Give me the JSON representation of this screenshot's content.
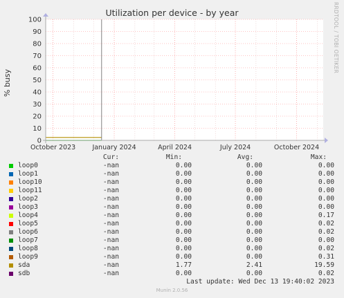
{
  "title": "Utilization per device - by year",
  "side_label": "RRDTOOL / TOBI OETIKER",
  "footer": "Munin 2.0.56",
  "last_update": "Last update: Wed Dec 13 19:40:02 2023",
  "colors": {
    "grid_minor": "#e0b0b0",
    "grid_major": "#ff9f9f",
    "background": "#ffffff",
    "axis": "#aaaaaa"
  },
  "legend": {
    "headers": [
      "Cur:",
      "Min:",
      "Avg:",
      "Max:"
    ],
    "rows": [
      {
        "name": "loop0",
        "color": "#00cc00",
        "cur": "-nan",
        "min": "0.00",
        "avg": "0.00",
        "max": "0.00"
      },
      {
        "name": "loop1",
        "color": "#0066b3",
        "cur": "-nan",
        "min": "0.00",
        "avg": "0.00",
        "max": "0.00"
      },
      {
        "name": "loop10",
        "color": "#ff8000",
        "cur": "-nan",
        "min": "0.00",
        "avg": "0.00",
        "max": "0.00"
      },
      {
        "name": "loop11",
        "color": "#ffcc00",
        "cur": "-nan",
        "min": "0.00",
        "avg": "0.00",
        "max": "0.00"
      },
      {
        "name": "loop2",
        "color": "#330099",
        "cur": "-nan",
        "min": "0.00",
        "avg": "0.00",
        "max": "0.00"
      },
      {
        "name": "loop3",
        "color": "#990099",
        "cur": "-nan",
        "min": "0.00",
        "avg": "0.00",
        "max": "0.00"
      },
      {
        "name": "loop4",
        "color": "#ccff00",
        "cur": "-nan",
        "min": "0.00",
        "avg": "0.00",
        "max": "0.17"
      },
      {
        "name": "loop5",
        "color": "#ff0000",
        "cur": "-nan",
        "min": "0.00",
        "avg": "0.00",
        "max": "0.02"
      },
      {
        "name": "loop6",
        "color": "#808080",
        "cur": "-nan",
        "min": "0.00",
        "avg": "0.00",
        "max": "0.02"
      },
      {
        "name": "loop7",
        "color": "#008f00",
        "cur": "-nan",
        "min": "0.00",
        "avg": "0.00",
        "max": "0.00"
      },
      {
        "name": "loop8",
        "color": "#00487d",
        "cur": "-nan",
        "min": "0.00",
        "avg": "0.00",
        "max": "0.02"
      },
      {
        "name": "loop9",
        "color": "#b35a00",
        "cur": "-nan",
        "min": "0.00",
        "avg": "0.00",
        "max": "0.31"
      },
      {
        "name": "sda",
        "color": "#b38f00",
        "cur": "-nan",
        "min": "1.77",
        "avg": "2.41",
        "max": "19.59"
      },
      {
        "name": "sdb",
        "color": "#6b006b",
        "cur": "-nan",
        "min": "0.00",
        "avg": "0.00",
        "max": "0.02"
      }
    ]
  },
  "chart_data": {
    "type": "line",
    "title": "Utilization per device - by year",
    "ylabel": "% busy",
    "ylim": [
      0,
      100
    ],
    "y_ticks": [
      0,
      10,
      20,
      30,
      40,
      50,
      60,
      70,
      80,
      90,
      100
    ],
    "x_range": [
      "2023-09-20",
      "2024-11-10"
    ],
    "x_ticks": [
      {
        "label": "October 2023",
        "date": "2023-10-01"
      },
      {
        "label": "January 2024",
        "date": "2024-01-01"
      },
      {
        "label": "April 2024",
        "date": "2024-04-01"
      },
      {
        "label": "July 2024",
        "date": "2024-07-01"
      },
      {
        "label": "October 2024",
        "date": "2024-10-01"
      }
    ],
    "grid": true,
    "series": [
      {
        "name": "sda",
        "color": "#b38f00",
        "x": [
          "2023-09-20",
          "2023-12-13"
        ],
        "y": [
          2.4,
          2.4
        ]
      },
      {
        "name": "loop0",
        "color": "#00cc00",
        "x": [
          "2023-09-20",
          "2023-12-13"
        ],
        "y": [
          0,
          0
        ]
      }
    ],
    "spike": {
      "date": "2023-12-13",
      "value": 100
    }
  }
}
